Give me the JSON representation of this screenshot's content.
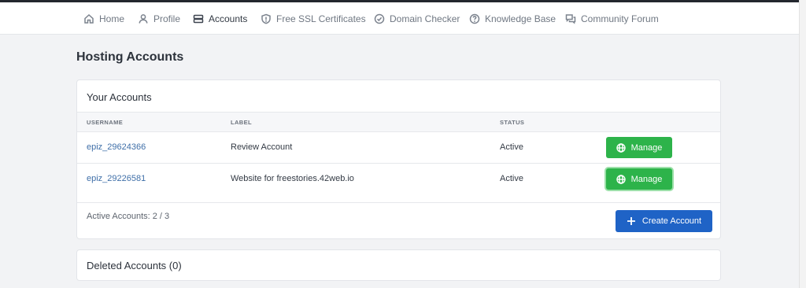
{
  "nav": {
    "items": [
      {
        "label": "Home",
        "icon": "home-icon"
      },
      {
        "label": "Profile",
        "icon": "user-icon"
      },
      {
        "label": "Accounts",
        "icon": "server-icon",
        "active": true
      },
      {
        "label": "Free SSL Certificates",
        "icon": "shield-icon"
      },
      {
        "label": "Domain Checker",
        "icon": "check-circle-icon"
      },
      {
        "label": "Knowledge Base",
        "icon": "question-circle-icon"
      },
      {
        "label": "Community Forum",
        "icon": "chat-icon"
      }
    ]
  },
  "page": {
    "title": "Hosting Accounts"
  },
  "accounts_card": {
    "title": "Your Accounts",
    "columns": {
      "username": "USERNAME",
      "label": "LABEL",
      "status": "STATUS"
    },
    "rows": [
      {
        "username": "epiz_29624366",
        "label": "Review Account",
        "status": "Active",
        "action": "Manage"
      },
      {
        "username": "epiz_29226581",
        "label": "Website for freestories.42web.io",
        "status": "Active",
        "action": "Manage"
      }
    ],
    "footer": {
      "active_count": "Active Accounts: 2 / 3",
      "create_label": "Create Account"
    }
  },
  "deleted_card": {
    "title": "Deleted Accounts (0)"
  },
  "colors": {
    "manage": "#2db34a",
    "create": "#1f63c6",
    "link": "#3f6fa8"
  }
}
